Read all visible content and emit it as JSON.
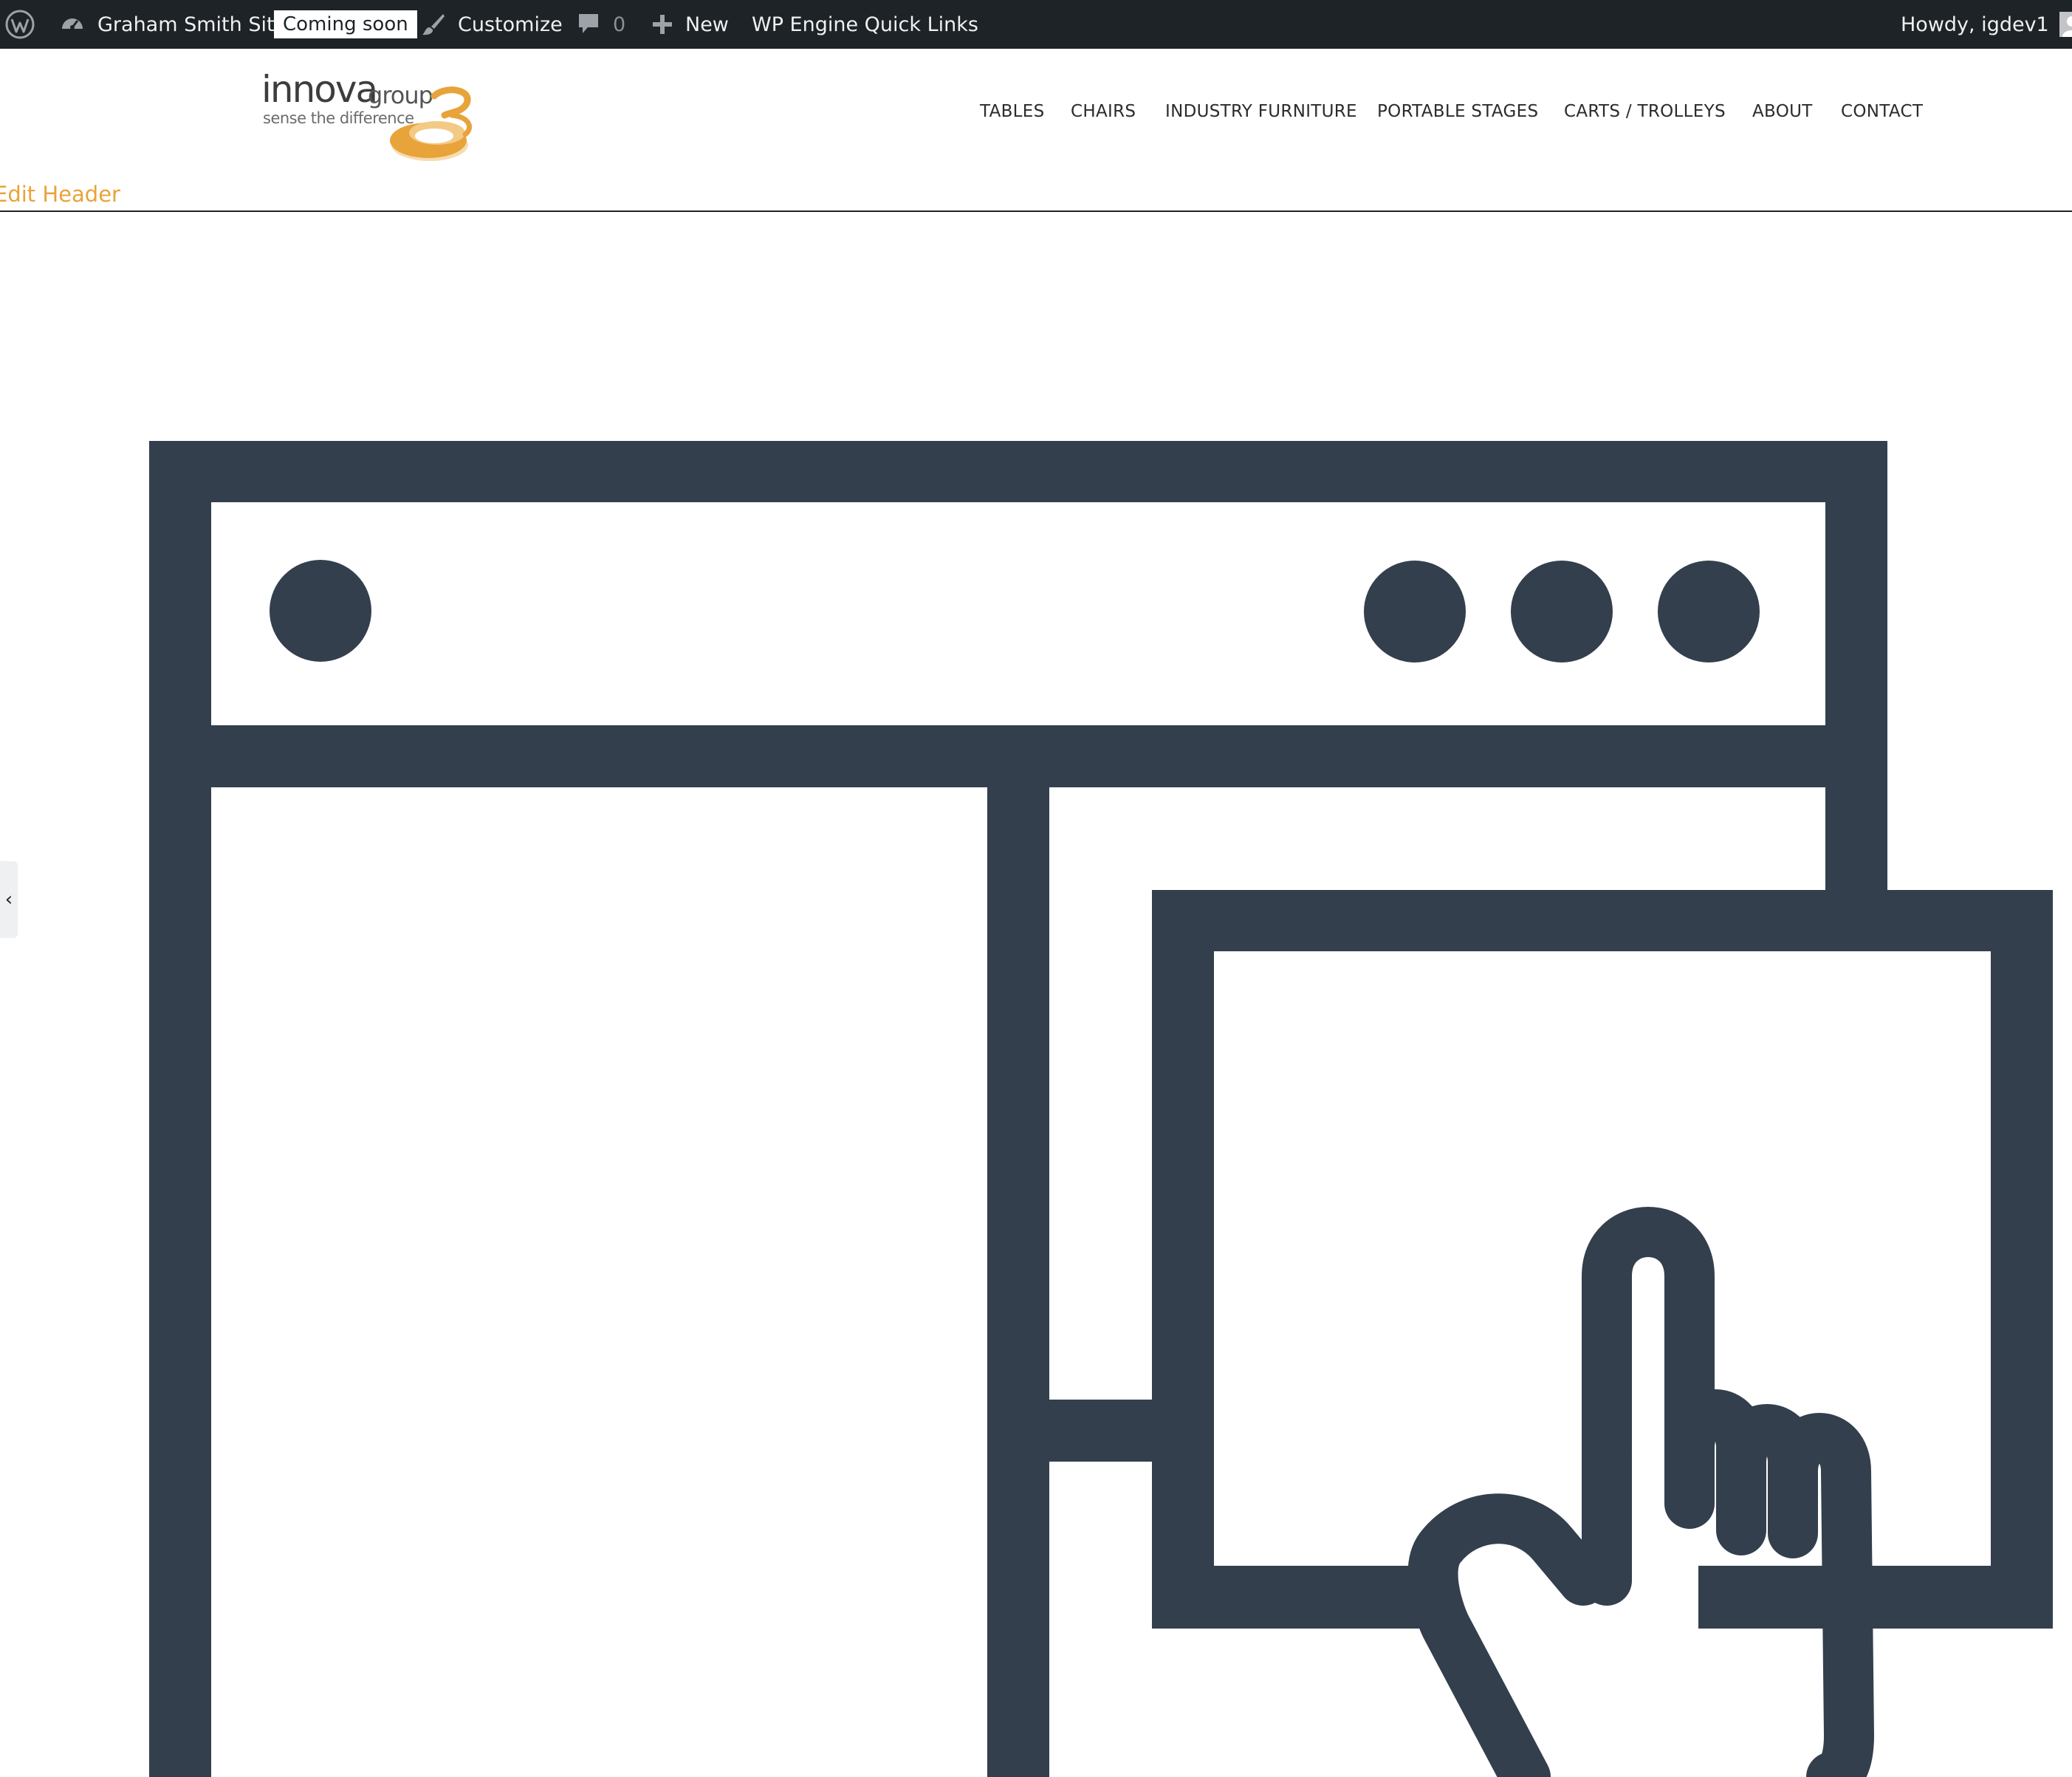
{
  "admin_bar": {
    "wp_logo_icon": "wordpress-logo-icon",
    "site_icon": "dashboard-icon",
    "site_name": "Graham Smith Site",
    "status_badge": "Coming soon",
    "customize_icon": "paintbrush-icon",
    "customize_label": "Customize",
    "comments_icon": "comment-icon",
    "comments_count": "0",
    "new_icon": "plus-icon",
    "new_label": "New",
    "wp_engine_label": "WP Engine Quick Links",
    "greeting": "Howdy, igdev1",
    "avatar_icon": "user-avatar-icon",
    "background": "#1d2327"
  },
  "site_header": {
    "logo": {
      "word": "innova",
      "group": "group",
      "tagline": "sense the difference",
      "accent_color": "#e8a33a"
    },
    "nav": [
      {
        "label": "TABLES"
      },
      {
        "label": "CHAIRS"
      },
      {
        "label": "INDUSTRY FURNITURE"
      },
      {
        "label": "PORTABLE STAGES"
      },
      {
        "label": "CARTS / TROLLEYS"
      },
      {
        "label": "ABOUT"
      },
      {
        "label": "CONTACT"
      }
    ],
    "edit_header_label": "Edit Header",
    "edit_header_color": "#e8a33a"
  },
  "placeholder": {
    "icon": "browser-window-click-icon",
    "stroke_color": "#333f4d"
  },
  "side_tab": {
    "icon": "chevron-left-icon",
    "glyph": "‹"
  }
}
